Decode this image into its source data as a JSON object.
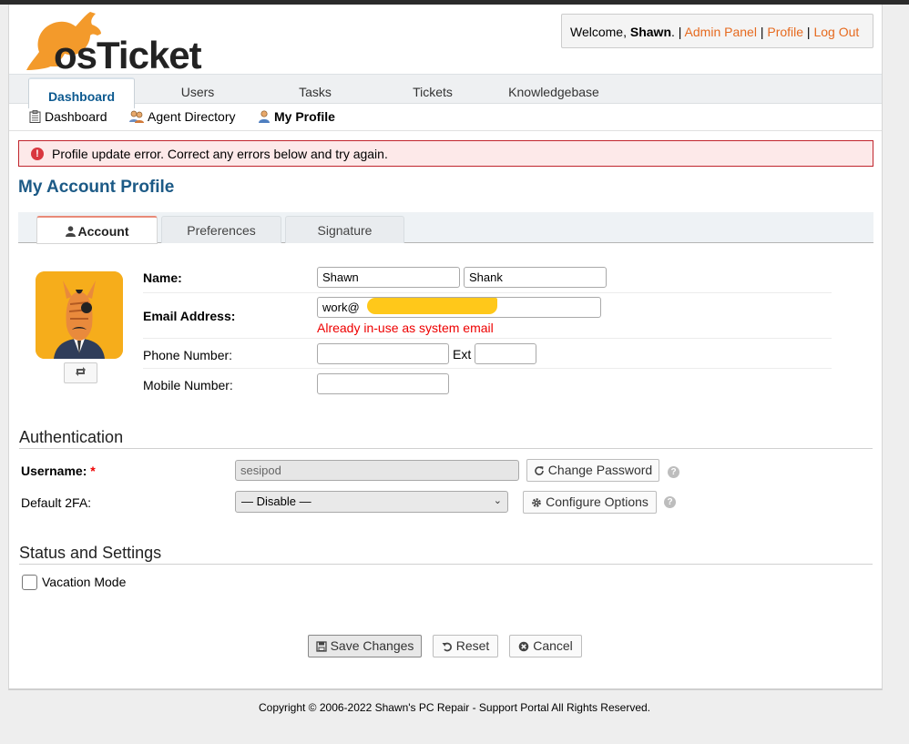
{
  "header": {
    "logo_text": "osTicket",
    "welcome_prefix": "Welcome, ",
    "user_name": "Shawn",
    "welcome_suffix": ". ",
    "links": [
      "Admin Panel",
      "Profile",
      "Log Out"
    ],
    "link_color": "#e66a1f"
  },
  "nav": {
    "tabs": [
      "Dashboard",
      "Users",
      "Tasks",
      "Tickets",
      "Knowledgebase"
    ],
    "active": "Dashboard"
  },
  "subnav": {
    "items": [
      "Dashboard",
      "Agent Directory",
      "My Profile"
    ],
    "active": "My Profile"
  },
  "alert": {
    "message": "Profile update error. Correct any errors below and try again."
  },
  "page": {
    "title": "My Account Profile",
    "tabs": [
      "Account",
      "Preferences",
      "Signature"
    ],
    "active_tab": "Account"
  },
  "account": {
    "name_label": "Name:",
    "first_name": "Shawn",
    "last_name": "Shank",
    "email_label": "Email Address:",
    "email_value": "work@",
    "email_error": "Already in-use as system email",
    "phone_label": "Phone Number:",
    "phone_value": "",
    "ext_label": "Ext",
    "ext_value": "",
    "mobile_label": "Mobile Number:",
    "mobile_value": ""
  },
  "authentication": {
    "title": "Authentication",
    "username_label": "Username:",
    "required_mark": "*",
    "username_value": "sesipod",
    "change_password_label": "Change Password",
    "twofa_label": "Default 2FA:",
    "twofa_selected": "— Disable —",
    "configure_label": "Configure Options",
    "help_glyph": "?"
  },
  "status": {
    "title": "Status and Settings",
    "vacation_label": "Vacation Mode",
    "vacation_checked": false
  },
  "actions": {
    "save_label": "Save Changes",
    "reset_label": "Reset",
    "cancel_label": "Cancel"
  },
  "footer": {
    "copyright": "Copyright © 2006-2022 Shawn's PC Repair - Support Portal All Rights Reserved."
  }
}
